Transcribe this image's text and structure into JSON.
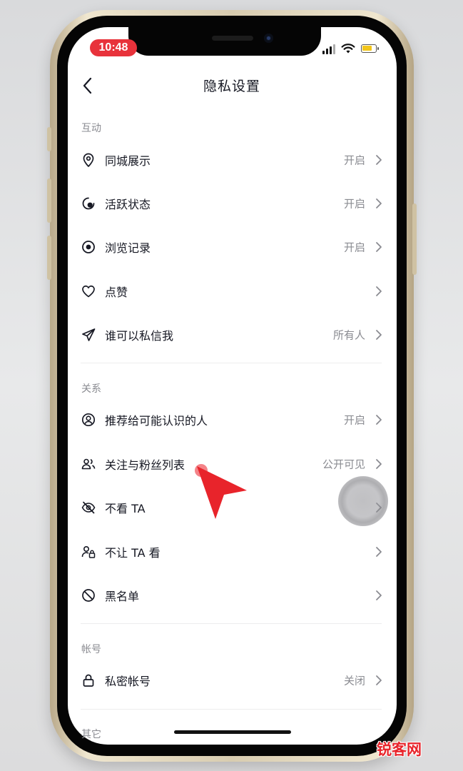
{
  "status_bar": {
    "time": "10:48"
  },
  "nav": {
    "title": "隐私设置"
  },
  "sections": [
    {
      "label": "互动",
      "items": [
        {
          "label": "同城展示",
          "value": "开启",
          "icon": "location-pin-icon"
        },
        {
          "label": "活跃状态",
          "value": "开启",
          "icon": "active-status-icon"
        },
        {
          "label": "浏览记录",
          "value": "开启",
          "icon": "eye-icon"
        },
        {
          "label": "点赞",
          "value": "",
          "icon": "heart-icon"
        },
        {
          "label": "谁可以私信我",
          "value": "所有人",
          "icon": "send-icon"
        }
      ]
    },
    {
      "label": "关系",
      "items": [
        {
          "label": "推荐给可能认识的人",
          "value": "开启",
          "icon": "user-circle-icon"
        },
        {
          "label": "关注与粉丝列表",
          "value": "公开可见",
          "icon": "users-icon"
        },
        {
          "label": "不看 TA",
          "value": "",
          "icon": "eye-off-icon"
        },
        {
          "label": "不让 TA 看",
          "value": "",
          "icon": "user-lock-icon"
        },
        {
          "label": "黑名单",
          "value": "",
          "icon": "block-icon"
        }
      ]
    },
    {
      "label": "帐号",
      "items": [
        {
          "label": "私密帐号",
          "value": "关闭",
          "icon": "lock-icon"
        }
      ]
    },
    {
      "label": "其它",
      "items": []
    }
  ],
  "watermark": "锐客网",
  "colors": {
    "accent_red": "#e8242b",
    "text_primary": "#161823",
    "text_secondary": "#8a8b91"
  }
}
